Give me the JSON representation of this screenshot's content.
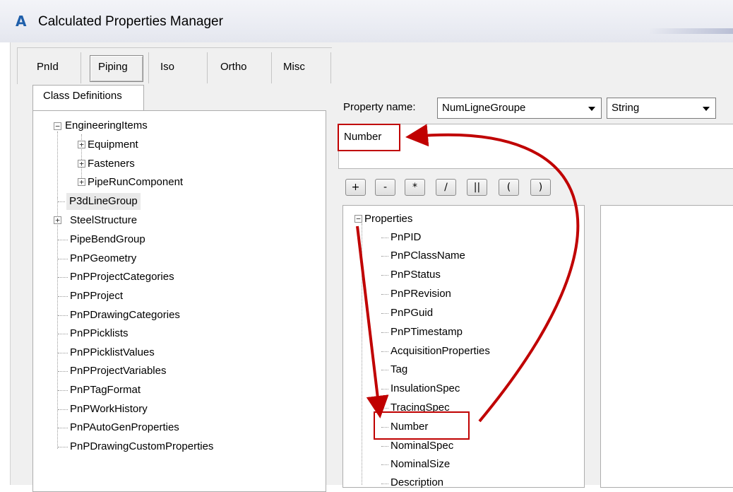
{
  "window": {
    "title": "Calculated Properties Manager",
    "logo": "A"
  },
  "tabs": [
    {
      "label": "PnId"
    },
    {
      "label": "Piping"
    },
    {
      "label": "Iso"
    },
    {
      "label": "Ortho"
    },
    {
      "label": "Misc"
    }
  ],
  "selected_tab": "Piping",
  "class_panel": {
    "tab_label": "Class Definitions",
    "tree": [
      "EngineeringItems",
      "Equipment",
      "Fasteners",
      "PipeRunComponent",
      "P3dLineGroup",
      "SteelStructure",
      "PipeBendGroup",
      "PnPGeometry",
      "PnPProjectCategories",
      "PnPProject",
      "PnPDrawingCategories",
      "PnPPicklists",
      "PnPPicklistValues",
      "PnPProjectVariables",
      "PnPTagFormat",
      "PnPWorkHistory",
      "PnPAutoGenProperties",
      "PnPDrawingCustomProperties"
    ]
  },
  "property": {
    "label": "Property name:",
    "name_value": "NumLigneGroupe",
    "type_value": "String",
    "expression": "Number"
  },
  "operators": [
    "+",
    "-",
    "*",
    "/",
    "||",
    "(",
    ")"
  ],
  "properties_tree": {
    "root": "Properties",
    "items": [
      "PnPID",
      "PnPClassName",
      "PnPStatus",
      "PnPRevision",
      "PnPGuid",
      "PnPTimestamp",
      "AcquisitionProperties",
      "Tag",
      "InsulationSpec",
      "TracingSpec",
      "Number",
      "NominalSpec",
      "NominalSize",
      "Description"
    ]
  },
  "colors": {
    "annotation": "#c00000",
    "logo": "#1f5faa"
  }
}
